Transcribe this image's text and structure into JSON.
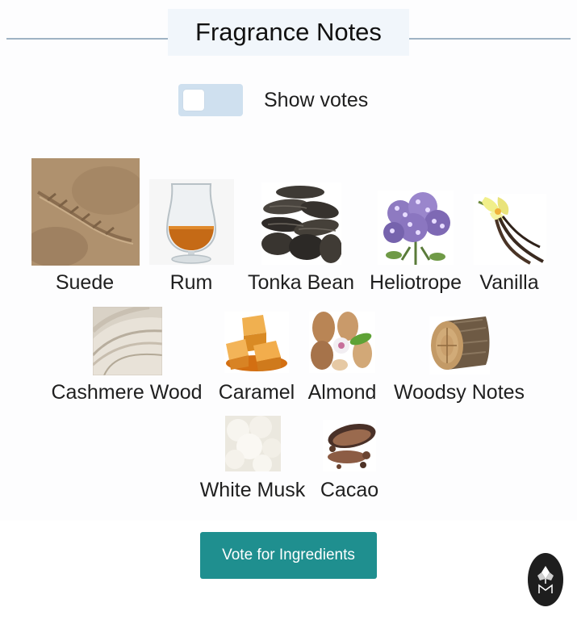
{
  "header": {
    "title": "Fragrance Notes"
  },
  "votes_toggle": {
    "label": "Show votes",
    "enabled": false
  },
  "notes": [
    {
      "name": "Suede",
      "icon": "suede-leather-image"
    },
    {
      "name": "Rum",
      "icon": "rum-glass-image"
    },
    {
      "name": "Tonka Bean",
      "icon": "tonka-bean-image"
    },
    {
      "name": "Heliotrope",
      "icon": "heliotrope-flower-image"
    },
    {
      "name": "Vanilla",
      "icon": "vanilla-pod-image"
    },
    {
      "name": "Cashmere Wood",
      "icon": "cashmere-fabric-image"
    },
    {
      "name": "Caramel",
      "icon": "caramel-cubes-image"
    },
    {
      "name": "Almond",
      "icon": "almond-image"
    },
    {
      "name": "Woodsy Notes",
      "icon": "wood-log-image"
    },
    {
      "name": "White Musk",
      "icon": "white-musk-image"
    },
    {
      "name": "Cacao",
      "icon": "cacao-image"
    }
  ],
  "footer": {
    "vote_button": "Vote for Ingredients"
  },
  "colors": {
    "accent": "#1f8f8f",
    "toggle_track": "#cfe0ef",
    "title_background": "#f1f6fb",
    "rule": "#9fb3c4"
  }
}
